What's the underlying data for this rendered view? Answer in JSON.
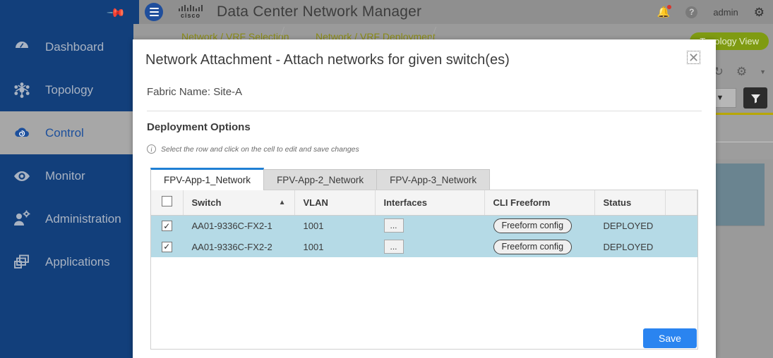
{
  "sidebar": {
    "pin_icon": "pin-icon",
    "items": [
      {
        "label": "Dashboard",
        "icon": "gauge-icon",
        "active": false
      },
      {
        "label": "Topology",
        "icon": "network-nodes-icon",
        "active": false
      },
      {
        "label": "Control",
        "icon": "cloud-icon",
        "active": true
      },
      {
        "label": "Monitor",
        "icon": "eye-icon",
        "active": false
      },
      {
        "label": "Administration",
        "icon": "user-gear-icon",
        "active": false
      },
      {
        "label": "Applications",
        "icon": "windows-stack-icon",
        "active": false
      }
    ]
  },
  "topbar": {
    "menu_icon": "hamburger-icon",
    "brand": "cisco",
    "title": "Data Center Network Manager",
    "notifications_icon": "bell-icon",
    "help_icon": "help-icon",
    "user": "admin",
    "settings_icon": "gear-icon"
  },
  "breadcrumb": {
    "items": [
      "Network / VRF Selection",
      "Network / VRF Deployment"
    ]
  },
  "background": {
    "topology_button": "Topology View",
    "refresh_icon": "refresh-icon",
    "gear_icon": "gear-icon",
    "caret_icon": "caret-down-icon",
    "dropdown_label": "▼",
    "filter_icon": "filter-icon"
  },
  "modal": {
    "title": "Network Attachment - Attach networks for given switch(es)",
    "close_label": "✕",
    "fabric_name": "Fabric Name: Site-A",
    "section_title": "Deployment Options",
    "hint_icon": "info-icon",
    "hint": "Select the row and click on the cell to edit and save changes",
    "tabs": [
      {
        "label": "FPV-App-1_Network",
        "active": true
      },
      {
        "label": "FPV-App-2_Network",
        "active": false
      },
      {
        "label": "FPV-App-3_Network",
        "active": false
      }
    ],
    "table": {
      "select_all_checked": false,
      "columns": [
        "",
        "Switch",
        "VLAN",
        "Interfaces",
        "CLI Freeform",
        "Status",
        ""
      ],
      "sort_column": "Switch",
      "sort_direction": "▲",
      "rows": [
        {
          "checked": true,
          "check_glyph": "✓",
          "switch": "AA01-9336C-FX2-1",
          "vlan": "1001",
          "interfaces": "...",
          "cli_freeform": "Freeform config",
          "status": "DEPLOYED"
        },
        {
          "checked": true,
          "check_glyph": "✓",
          "switch": "AA01-9336C-FX2-2",
          "vlan": "1001",
          "interfaces": "...",
          "cli_freeform": "Freeform config",
          "status": "DEPLOYED"
        }
      ]
    },
    "save_label": "Save"
  },
  "colors": {
    "sidebar_navy": "#123f7b",
    "active_nav": "#a7a7a7",
    "accent_blue": "#2a84f0",
    "tab_active_border": "#1f7fd4",
    "row_selected": "#b5dae6",
    "breadcrumb_olive": "#8a8b15",
    "topology_green": "#7f9b12"
  }
}
